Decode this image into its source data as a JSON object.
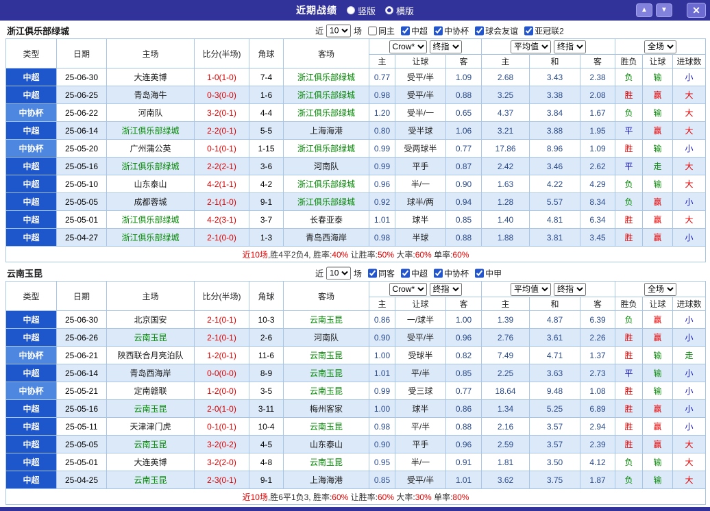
{
  "titlebar": {
    "title": "近期战绩",
    "radios": [
      {
        "label": "竖版",
        "selected": false
      },
      {
        "label": "横版",
        "selected": true
      }
    ],
    "buttons": [
      {
        "name": "up",
        "glyph": "▲"
      },
      {
        "name": "down",
        "glyph": "▼"
      },
      {
        "name": "close",
        "glyph": "✕"
      }
    ]
  },
  "colors": {
    "titlebar_bg": "#32329b",
    "league_csl": "#1e56cc",
    "league_cup": "#4e87e0",
    "row_alt": "#dce9f8",
    "win_red": "#e60000",
    "loss_green": "#0a8a0a",
    "draw_blue": "#1414c8",
    "focus_team_green": "#008800"
  },
  "table_header": {
    "cols": [
      "类型",
      "日期",
      "主场",
      "比分(半场)",
      "角球",
      "客场"
    ],
    "bookmaker": "Crow*",
    "stage": "终指",
    "average": "平均值",
    "stage2": "终指",
    "scope": "全场",
    "sub": [
      "主",
      "让球",
      "客",
      "主",
      "和",
      "客",
      "胜负",
      "让球",
      "进球数"
    ]
  },
  "sections": [
    {
      "team": "浙江俱乐部绿城",
      "filter": {
        "near_label": "近",
        "count": "10",
        "games_label": "场",
        "checkboxes": [
          {
            "label": "同主",
            "checked": false
          },
          {
            "label": "中超",
            "checked": true
          },
          {
            "label": "中协杯",
            "checked": true
          },
          {
            "label": "球会友谊",
            "checked": true
          },
          {
            "label": "亚冠联2",
            "checked": true
          }
        ]
      },
      "rows": [
        [
          "中超",
          "25-06-30",
          "大连英博",
          "1-0(1-0)",
          "7-4",
          "浙江俱乐部绿城",
          "0.77",
          "受平/半",
          "1.09",
          "2.68",
          "3.43",
          "2.38",
          "负",
          "输",
          "小"
        ],
        [
          "中超",
          "25-06-25",
          "青岛海牛",
          "0-3(0-0)",
          "1-6",
          "浙江俱乐部绿城",
          "0.98",
          "受平/半",
          "0.88",
          "3.25",
          "3.38",
          "2.08",
          "胜",
          "赢",
          "大"
        ],
        [
          "中协杯",
          "25-06-22",
          "河南队",
          "3-2(0-1)",
          "4-4",
          "浙江俱乐部绿城",
          "1.20",
          "受半/一",
          "0.65",
          "4.37",
          "3.84",
          "1.67",
          "负",
          "输",
          "大"
        ],
        [
          "中超",
          "25-06-14",
          "浙江俱乐部绿城",
          "2-2(0-1)",
          "5-5",
          "上海海港",
          "0.80",
          "受半球",
          "1.06",
          "3.21",
          "3.88",
          "1.95",
          "平",
          "赢",
          "大"
        ],
        [
          "中协杯",
          "25-05-20",
          "广州蒲公英",
          "0-1(0-1)",
          "1-15",
          "浙江俱乐部绿城",
          "0.99",
          "受两球半",
          "0.77",
          "17.86",
          "8.96",
          "1.09",
          "胜",
          "输",
          "小"
        ],
        [
          "中超",
          "25-05-16",
          "浙江俱乐部绿城",
          "2-2(2-1)",
          "3-6",
          "河南队",
          "0.99",
          "平手",
          "0.87",
          "2.42",
          "3.46",
          "2.62",
          "平",
          "走",
          "大"
        ],
        [
          "中超",
          "25-05-10",
          "山东泰山",
          "4-2(1-1)",
          "4-2",
          "浙江俱乐部绿城",
          "0.96",
          "半/一",
          "0.90",
          "1.63",
          "4.22",
          "4.29",
          "负",
          "输",
          "大"
        ],
        [
          "中超",
          "25-05-05",
          "成都蓉城",
          "2-1(1-0)",
          "9-1",
          "浙江俱乐部绿城",
          "0.92",
          "球半/两",
          "0.94",
          "1.28",
          "5.57",
          "8.34",
          "负",
          "赢",
          "小"
        ],
        [
          "中超",
          "25-05-01",
          "浙江俱乐部绿城",
          "4-2(3-1)",
          "3-7",
          "长春亚泰",
          "1.01",
          "球半",
          "0.85",
          "1.40",
          "4.81",
          "6.34",
          "胜",
          "赢",
          "大"
        ],
        [
          "中超",
          "25-04-27",
          "浙江俱乐部绿城",
          "2-1(0-0)",
          "1-3",
          "青岛西海岸",
          "0.98",
          "半球",
          "0.88",
          "1.88",
          "3.81",
          "3.45",
          "胜",
          "赢",
          "小"
        ]
      ],
      "summary": [
        {
          "text": "近10场",
          "color": "red"
        },
        {
          "text": ",胜4平2负4, 胜率:",
          "color": "dark"
        },
        {
          "text": "40%",
          "color": "red"
        },
        {
          "text": " 让胜率:",
          "color": "dark"
        },
        {
          "text": "50%",
          "color": "red"
        },
        {
          "text": " 大率:",
          "color": "dark"
        },
        {
          "text": "60%",
          "color": "red"
        },
        {
          "text": " 单率:",
          "color": "dark"
        },
        {
          "text": "60%",
          "color": "red"
        }
      ]
    },
    {
      "team": "云南玉昆",
      "filter": {
        "near_label": "近",
        "count": "10",
        "games_label": "场",
        "checkboxes": [
          {
            "label": "同客",
            "checked": true
          },
          {
            "label": "中超",
            "checked": true
          },
          {
            "label": "中协杯",
            "checked": true
          },
          {
            "label": "中甲",
            "checked": true
          }
        ]
      },
      "rows": [
        [
          "中超",
          "25-06-30",
          "北京国安",
          "2-1(0-1)",
          "10-3",
          "云南玉昆",
          "0.86",
          "一/球半",
          "1.00",
          "1.39",
          "4.87",
          "6.39",
          "负",
          "赢",
          "小"
        ],
        [
          "中超",
          "25-06-26",
          "云南玉昆",
          "2-1(0-1)",
          "2-6",
          "河南队",
          "0.90",
          "受平/半",
          "0.96",
          "2.76",
          "3.61",
          "2.26",
          "胜",
          "赢",
          "小"
        ],
        [
          "中协杯",
          "25-06-21",
          "陕西联合月亮泊队",
          "1-2(0-1)",
          "11-6",
          "云南玉昆",
          "1.00",
          "受球半",
          "0.82",
          "7.49",
          "4.71",
          "1.37",
          "胜",
          "输",
          "走"
        ],
        [
          "中超",
          "25-06-14",
          "青岛西海岸",
          "0-0(0-0)",
          "8-9",
          "云南玉昆",
          "1.01",
          "平/半",
          "0.85",
          "2.25",
          "3.63",
          "2.73",
          "平",
          "输",
          "小"
        ],
        [
          "中协杯",
          "25-05-21",
          "定南赣联",
          "1-2(0-0)",
          "3-5",
          "云南玉昆",
          "0.99",
          "受三球",
          "0.77",
          "18.64",
          "9.48",
          "1.08",
          "胜",
          "输",
          "小"
        ],
        [
          "中超",
          "25-05-16",
          "云南玉昆",
          "2-0(1-0)",
          "3-11",
          "梅州客家",
          "1.00",
          "球半",
          "0.86",
          "1.34",
          "5.25",
          "6.89",
          "胜",
          "赢",
          "小"
        ],
        [
          "中超",
          "25-05-11",
          "天津津门虎",
          "0-1(0-1)",
          "10-4",
          "云南玉昆",
          "0.98",
          "平/半",
          "0.88",
          "2.16",
          "3.57",
          "2.94",
          "胜",
          "赢",
          "小"
        ],
        [
          "中超",
          "25-05-05",
          "云南玉昆",
          "3-2(0-2)",
          "4-5",
          "山东泰山",
          "0.90",
          "平手",
          "0.96",
          "2.59",
          "3.57",
          "2.39",
          "胜",
          "赢",
          "大"
        ],
        [
          "中超",
          "25-05-01",
          "大连英博",
          "3-2(2-0)",
          "4-8",
          "云南玉昆",
          "0.95",
          "半/一",
          "0.91",
          "1.81",
          "3.50",
          "4.12",
          "负",
          "输",
          "大"
        ],
        [
          "中超",
          "25-04-25",
          "云南玉昆",
          "2-3(0-1)",
          "9-1",
          "上海海港",
          "0.85",
          "受平/半",
          "1.01",
          "3.62",
          "3.75",
          "1.87",
          "负",
          "输",
          "大"
        ]
      ],
      "summary": [
        {
          "text": "近10场",
          "color": "red"
        },
        {
          "text": ",胜6平1负3, 胜率:",
          "color": "dark"
        },
        {
          "text": "60%",
          "color": "red"
        },
        {
          "text": " 让胜率:",
          "color": "dark"
        },
        {
          "text": "60%",
          "color": "red"
        },
        {
          "text": " 大率:",
          "color": "dark"
        },
        {
          "text": "30%",
          "color": "red"
        },
        {
          "text": " 单率:",
          "color": "dark"
        },
        {
          "text": "80%",
          "color": "red"
        }
      ]
    }
  ]
}
